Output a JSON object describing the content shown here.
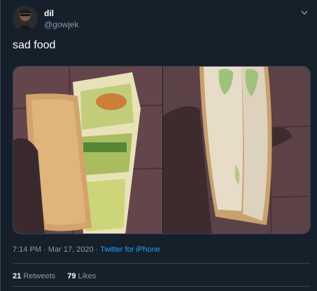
{
  "author": {
    "name": "dil",
    "handle": "@gowjek"
  },
  "tweet_text": "sad food",
  "media": {
    "left_icon": "photo-bread-in-packaging",
    "right_icon": "photo-bread-split-open"
  },
  "meta": {
    "time": "7:14 PM",
    "separator": " · ",
    "date": "Mar 17, 2020",
    "separator2": " · ",
    "source": "Twitter for iPhone"
  },
  "stats": {
    "retweets_count": "21",
    "retweets_label": "Retweets",
    "likes_count": "79",
    "likes_label": "Likes"
  },
  "colors": {
    "background": "#15202b",
    "text": "#ffffff",
    "secondary": "#8899a6",
    "link": "#1da1f2",
    "border": "#38444d"
  }
}
